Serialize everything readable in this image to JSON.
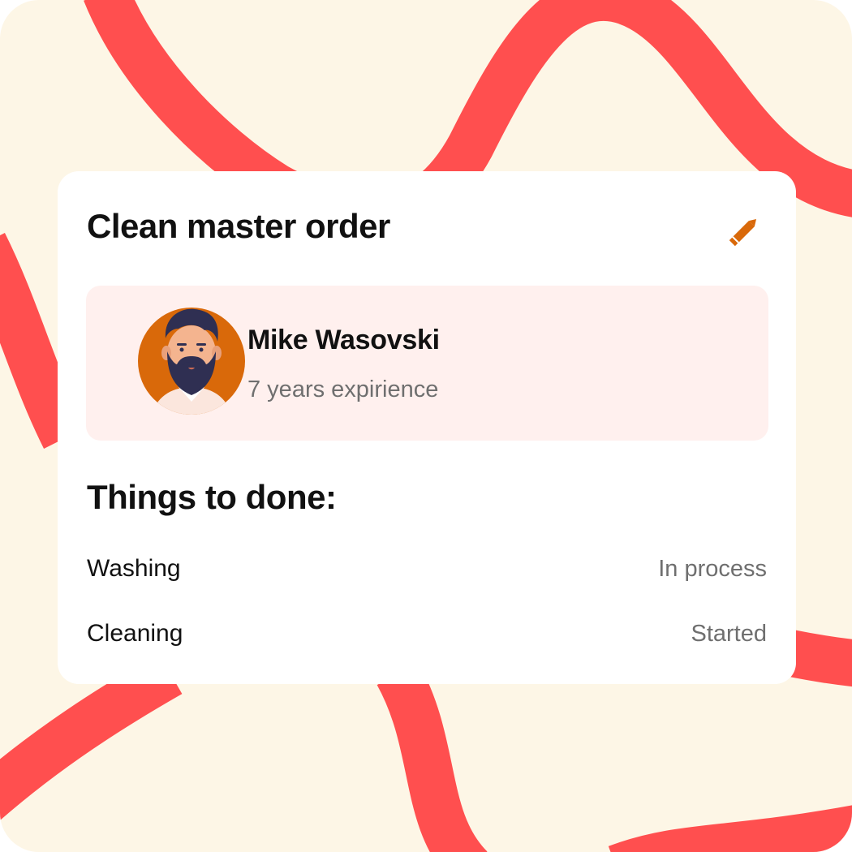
{
  "colors": {
    "background": "#fdf6e6",
    "wave": "#ff4f4f",
    "card": "#ffffff",
    "profile_bg": "#fff0ee",
    "accent": "#d9690a",
    "text_primary": "#111111",
    "text_secondary": "#6f6f6f"
  },
  "card": {
    "title": "Clean master order",
    "edit_icon": "pencil-icon"
  },
  "master": {
    "avatar_icon": "bearded-man-avatar",
    "name": "Mike Wasovski",
    "experience": "7 years expirience"
  },
  "todo": {
    "title": "Things to done:",
    "items": [
      {
        "task": "Washing",
        "status": "In process"
      },
      {
        "task": "Cleaning",
        "status": "Started"
      }
    ]
  }
}
